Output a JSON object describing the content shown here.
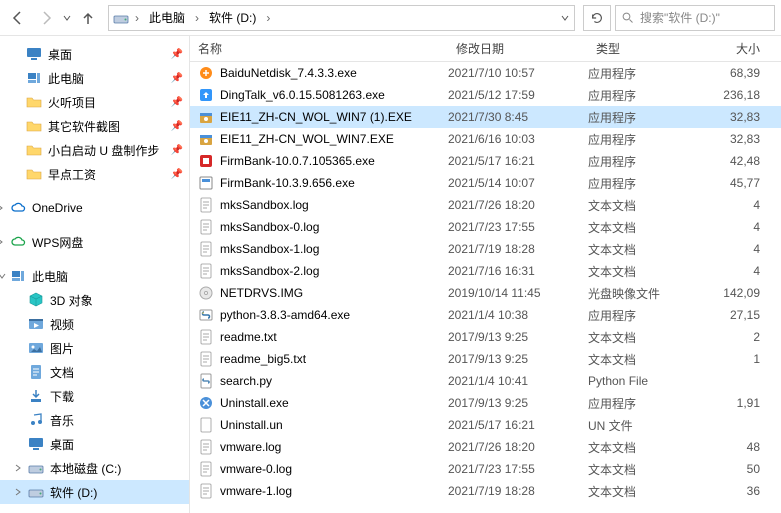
{
  "toolbar": {
    "breadcrumb": [
      {
        "label": "此电脑"
      },
      {
        "label": "软件 (D:)"
      }
    ],
    "search_placeholder": "搜索\"软件 (D:)\""
  },
  "sidebar": {
    "quick": [
      {
        "name": "desktop",
        "label": "桌面",
        "icon": "monitor",
        "pinned": true,
        "indent": 26
      },
      {
        "name": "this-pc",
        "label": "此电脑",
        "icon": "pc",
        "pinned": true,
        "indent": 26
      },
      {
        "name": "huoting",
        "label": "火听项目",
        "icon": "folder",
        "pinned": true,
        "indent": 26
      },
      {
        "name": "screenshots",
        "label": "其它软件截图",
        "icon": "folder",
        "pinned": true,
        "indent": 26
      },
      {
        "name": "xiaobai",
        "label": "小白启动 U 盘制作步",
        "icon": "folder",
        "pinned": true,
        "indent": 26
      },
      {
        "name": "salary",
        "label": "早点工资",
        "icon": "folder",
        "pinned": true,
        "indent": 26
      }
    ],
    "cloud": [
      {
        "name": "onedrive",
        "label": "OneDrive",
        "icon": "cloud-blue",
        "indent": 10,
        "chev": true
      },
      {
        "name": "wps",
        "label": "WPS网盘",
        "icon": "cloud-green",
        "indent": 10,
        "chev": true
      }
    ],
    "pc_label": "此电脑",
    "pc_children": [
      {
        "name": "3d",
        "label": "3D 对象",
        "icon": "cube",
        "indent": 28
      },
      {
        "name": "video",
        "label": "视频",
        "icon": "video",
        "indent": 28
      },
      {
        "name": "pictures",
        "label": "图片",
        "icon": "image",
        "indent": 28
      },
      {
        "name": "docs",
        "label": "文档",
        "icon": "doc",
        "indent": 28
      },
      {
        "name": "downloads",
        "label": "下载",
        "icon": "download",
        "indent": 28
      },
      {
        "name": "music",
        "label": "音乐",
        "icon": "music",
        "indent": 28
      },
      {
        "name": "desktop2",
        "label": "桌面",
        "icon": "monitor",
        "indent": 28
      },
      {
        "name": "disk-c",
        "label": "本地磁盘 (C:)",
        "icon": "drive",
        "indent": 28,
        "chev": true
      },
      {
        "name": "disk-d",
        "label": "软件 (D:)",
        "icon": "drive",
        "indent": 28,
        "chev": true,
        "selected": true
      }
    ]
  },
  "headers": {
    "name": "名称",
    "date": "修改日期",
    "type": "类型",
    "size": "大小"
  },
  "files": [
    {
      "name": "BaiduNetdisk_7.4.3.3.exe",
      "date": "2021/7/10 10:57",
      "type": "应用程序",
      "size": "68,39",
      "icon": "exe-orange"
    },
    {
      "name": "DingTalk_v6.0.15.5081263.exe",
      "date": "2021/5/12 17:59",
      "type": "应用程序",
      "size": "236,18",
      "icon": "exe-blue"
    },
    {
      "name": "EIE11_ZH-CN_WOL_WIN7 (1).EXE",
      "date": "2021/7/30 8:45",
      "type": "应用程序",
      "size": "32,83",
      "icon": "installer",
      "selected": true
    },
    {
      "name": "EIE11_ZH-CN_WOL_WIN7.EXE",
      "date": "2021/6/16 10:03",
      "type": "应用程序",
      "size": "32,83",
      "icon": "installer"
    },
    {
      "name": "FirmBank-10.0.7.105365.exe",
      "date": "2021/5/17 16:21",
      "type": "应用程序",
      "size": "42,48",
      "icon": "exe-red"
    },
    {
      "name": "FirmBank-10.3.9.656.exe",
      "date": "2021/5/14 10:07",
      "type": "应用程序",
      "size": "45,77",
      "icon": "exe-generic"
    },
    {
      "name": "mksSandbox.log",
      "date": "2021/7/26 18:20",
      "type": "文本文档",
      "size": "4",
      "icon": "txt"
    },
    {
      "name": "mksSandbox-0.log",
      "date": "2021/7/23 17:55",
      "type": "文本文档",
      "size": "4",
      "icon": "txt"
    },
    {
      "name": "mksSandbox-1.log",
      "date": "2021/7/19 18:28",
      "type": "文本文档",
      "size": "4",
      "icon": "txt"
    },
    {
      "name": "mksSandbox-2.log",
      "date": "2021/7/16 16:31",
      "type": "文本文档",
      "size": "4",
      "icon": "txt"
    },
    {
      "name": "NETDRVS.IMG",
      "date": "2019/10/14 11:45",
      "type": "光盘映像文件",
      "size": "142,09",
      "icon": "disc"
    },
    {
      "name": "python-3.8.3-amd64.exe",
      "date": "2021/1/4 10:38",
      "type": "应用程序",
      "size": "27,15",
      "icon": "python"
    },
    {
      "name": "readme.txt",
      "date": "2017/9/13 9:25",
      "type": "文本文档",
      "size": "2",
      "icon": "txt"
    },
    {
      "name": "readme_big5.txt",
      "date": "2017/9/13 9:25",
      "type": "文本文档",
      "size": "1",
      "icon": "txt"
    },
    {
      "name": "search.py",
      "date": "2021/1/4 10:41",
      "type": "Python File",
      "size": "",
      "icon": "py"
    },
    {
      "name": "Uninstall.exe",
      "date": "2017/9/13 9:25",
      "type": "应用程序",
      "size": "1,91",
      "icon": "exe-uninst"
    },
    {
      "name": "Uninstall.un",
      "date": "2021/5/17 16:21",
      "type": "UN 文件",
      "size": "",
      "icon": "file"
    },
    {
      "name": "vmware.log",
      "date": "2021/7/26 18:20",
      "type": "文本文档",
      "size": "48",
      "icon": "txt"
    },
    {
      "name": "vmware-0.log",
      "date": "2021/7/23 17:55",
      "type": "文本文档",
      "size": "50",
      "icon": "txt"
    },
    {
      "name": "vmware-1.log",
      "date": "2021/7/19 18:28",
      "type": "文本文档",
      "size": "36",
      "icon": "txt"
    }
  ]
}
